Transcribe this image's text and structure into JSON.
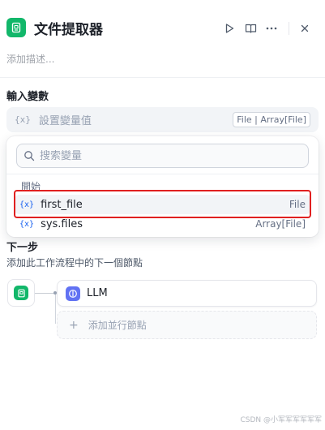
{
  "header": {
    "title": "文件提取器",
    "actions": [
      "play-icon",
      "book-icon",
      "more-icon",
      "close-icon"
    ]
  },
  "description_placeholder": "添加描述...",
  "input_section": {
    "label": "輸入變數",
    "field": {
      "icon": "{x}",
      "placeholder": "設置變量值",
      "type_tag": "File | Array[File]"
    }
  },
  "dropdown": {
    "search_placeholder": "搜索變量",
    "group_label": "開始",
    "items": [
      {
        "icon": "{x}",
        "name": "first_file",
        "type": "File",
        "highlighted": true
      },
      {
        "icon": "{x}",
        "name": "sys.files",
        "type": "Array[File]",
        "highlighted": false
      }
    ]
  },
  "next_step": {
    "label": "下一步",
    "subtitle": "添加此工作流程中的下一個節點",
    "node": {
      "label": "LLM"
    },
    "add_parallel": "添加並行節點"
  },
  "watermark": "CSDN @小军军军军军军",
  "colors": {
    "accent_green": "#12b76a",
    "llm_indigo": "#6172f3",
    "variable_blue": "#155eef",
    "highlight_red": "#e02020"
  }
}
